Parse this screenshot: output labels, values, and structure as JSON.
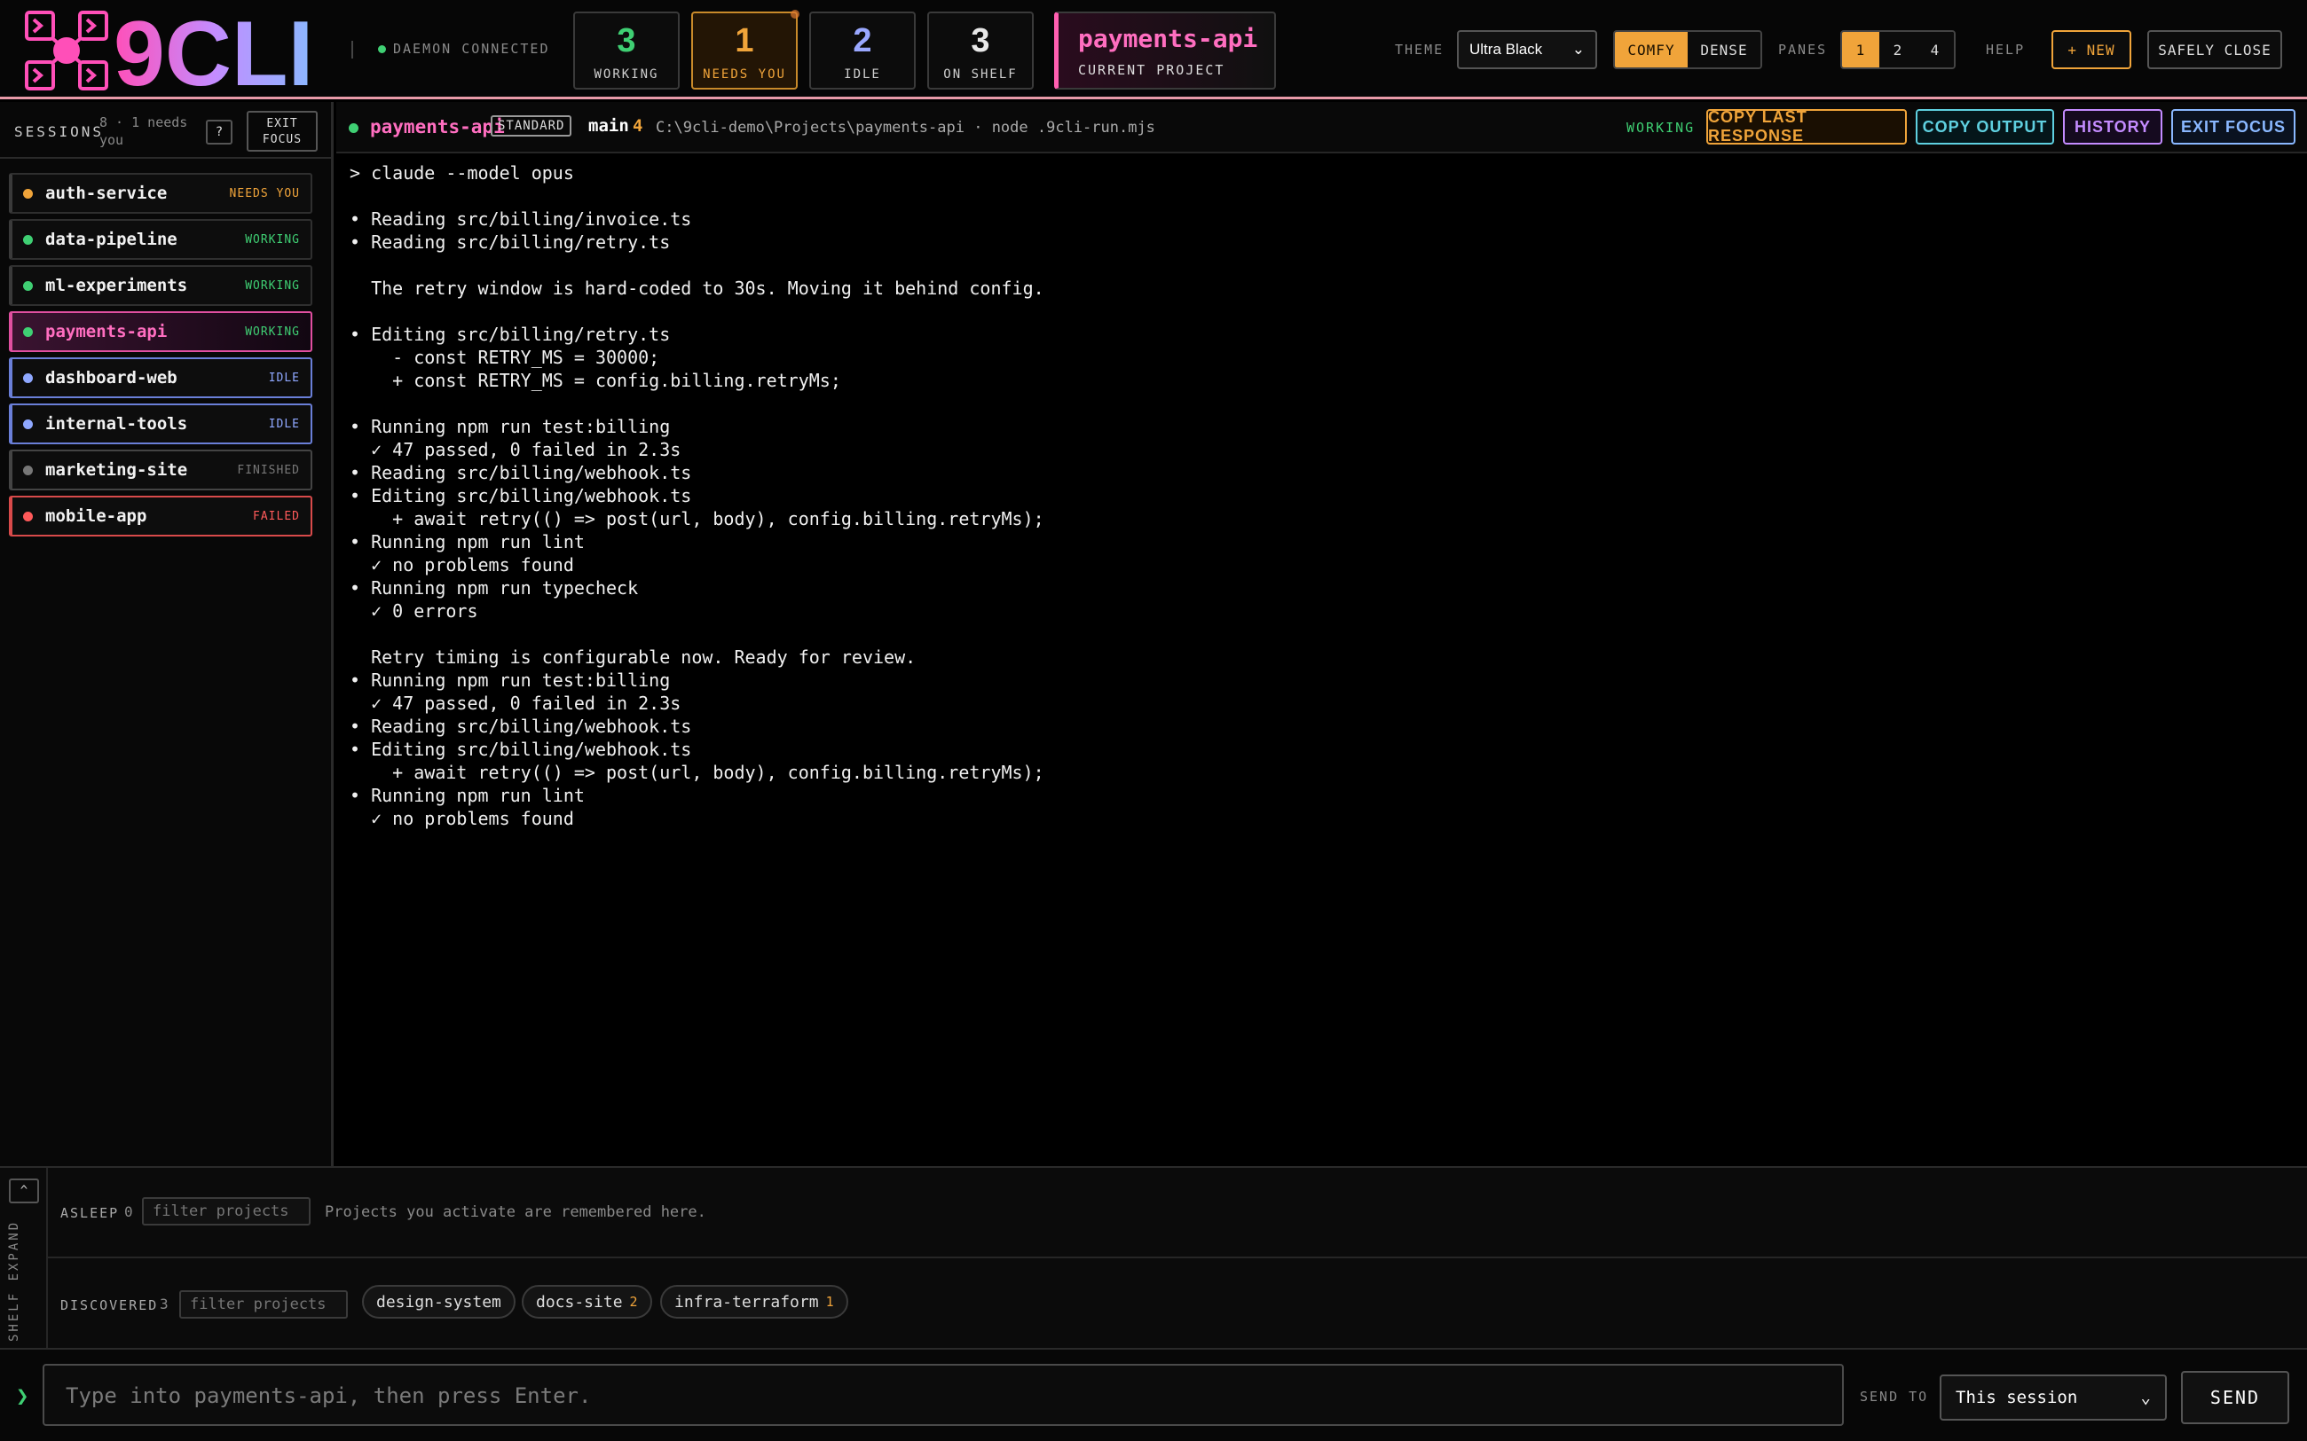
{
  "header": {
    "logo_text": "9CLI",
    "daemon_status": "DAEMON CONNECTED",
    "stats": [
      {
        "value": "3",
        "label": "WORKING",
        "color": "#3fcf73"
      },
      {
        "value": "1",
        "label": "NEEDS YOU",
        "color": "#f0a43a"
      },
      {
        "value": "2",
        "label": "IDLE",
        "color": "#9aa8ff"
      },
      {
        "value": "3",
        "label": "ON SHELF",
        "color": "#e8e8e8"
      }
    ],
    "current_project": {
      "name": "payments-api",
      "label": "CURRENT PROJECT"
    },
    "theme_label": "THEME",
    "theme_value": "Ultra Black",
    "density": {
      "comfy": "COMFY",
      "dense": "DENSE"
    },
    "panes_label": "PANES",
    "panes": [
      "1",
      "2",
      "4"
    ],
    "help": "HELP",
    "new_button": "+ NEW",
    "safely_close": "SAFELY CLOSE"
  },
  "sidebar": {
    "title": "SESSIONS",
    "count": "8 · 1 needs you",
    "help": "?",
    "exit_focus": "EXIT FOCUS",
    "items": [
      {
        "name": "auth-service",
        "status": "NEEDS YOU",
        "dot": "#f0a43a",
        "status_color": "#f0a43a",
        "border": "#2f2f2f"
      },
      {
        "name": "data-pipeline",
        "status": "WORKING",
        "dot": "#3fcf73",
        "status_color": "#3fcf73",
        "border": "#2f2f2f"
      },
      {
        "name": "ml-experiments",
        "status": "WORKING",
        "dot": "#3fcf73",
        "status_color": "#3fcf73",
        "border": "#2f2f2f"
      },
      {
        "name": "payments-api",
        "status": "WORKING",
        "dot": "#3fcf73",
        "status_color": "#3fcf73",
        "border": "#e04fa0"
      },
      {
        "name": "dashboard-web",
        "status": "IDLE",
        "dot": "#8fa8ff",
        "status_color": "#8fa8ff",
        "border": "#6a7fd8"
      },
      {
        "name": "internal-tools",
        "status": "IDLE",
        "dot": "#8fa8ff",
        "status_color": "#8fa8ff",
        "border": "#6a7fd8"
      },
      {
        "name": "marketing-site",
        "status": "FINISHED",
        "dot": "#777777",
        "status_color": "#777777",
        "border": "#444444"
      },
      {
        "name": "mobile-app",
        "status": "FAILED",
        "dot": "#ff5a5a",
        "status_color": "#ff5a5a",
        "border": "#d84a4a"
      }
    ]
  },
  "pane": {
    "name": "payments-api",
    "badge": "STANDARD",
    "branch": "main",
    "ahead": "4",
    "path": "C:\\9cli-demo\\Projects\\payments-api · node .9cli-run.mjs",
    "status": "WORKING",
    "buttons": {
      "copy_last": "COPY LAST RESPONSE",
      "copy_output": "COPY OUTPUT",
      "history": "HISTORY",
      "exit_focus": "EXIT FOCUS"
    }
  },
  "terminal_lines": [
    "> claude --model opus",
    "",
    "• Reading src/billing/invoice.ts",
    "• Reading src/billing/retry.ts",
    "",
    "  The retry window is hard-coded to 30s. Moving it behind config.",
    "",
    "• Editing src/billing/retry.ts",
    "    - const RETRY_MS = 30000;",
    "    + const RETRY_MS = config.billing.retryMs;",
    "",
    "• Running npm run test:billing",
    "  ✓ 47 passed, 0 failed in 2.3s",
    "• Reading src/billing/webhook.ts",
    "• Editing src/billing/webhook.ts",
    "    + await retry(() => post(url, body), config.billing.retryMs);",
    "• Running npm run lint",
    "  ✓ no problems found",
    "• Running npm run typecheck",
    "  ✓ 0 errors",
    "",
    "  Retry timing is configurable now. Ready for review.",
    "• Running npm run test:billing",
    "  ✓ 47 passed, 0 failed in 2.3s",
    "• Reading src/billing/webhook.ts",
    "• Editing src/billing/webhook.ts",
    "    + await retry(() => post(url, body), config.billing.retryMs);",
    "• Running npm run lint",
    "  ✓ no problems found"
  ],
  "shelf": {
    "expand_label": "SHELF  EXPAND",
    "toggle": "^",
    "asleep": {
      "label": "ASLEEP",
      "count": "0",
      "placeholder": "filter projects",
      "hint": "Projects you activate are remembered here."
    },
    "discovered": {
      "label": "DISCOVERED",
      "count": "3",
      "placeholder": "filter projects",
      "chips": [
        {
          "name": "design-system",
          "count": ""
        },
        {
          "name": "docs-site",
          "count": "2"
        },
        {
          "name": "infra-terraform",
          "count": "1"
        }
      ]
    }
  },
  "inputbar": {
    "chevron": "❯",
    "placeholder": "Type into payments-api, then press Enter.",
    "send_to_label": "SEND TO",
    "send_to_value": "This session",
    "send": "SEND"
  }
}
